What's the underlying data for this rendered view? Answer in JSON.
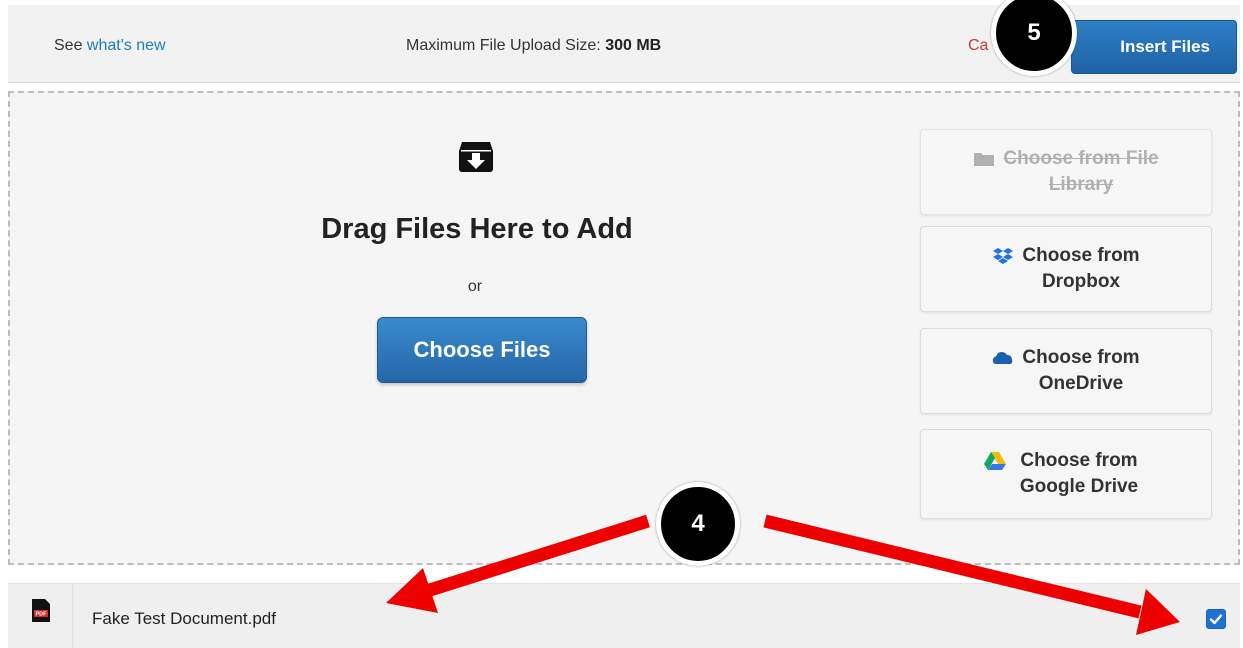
{
  "header": {
    "see_prefix": "See",
    "whats_new_link": "what's new",
    "max_size_label": "Maximum File Upload Size:",
    "max_size_value": "300 MB",
    "cancel_partial": "Ca",
    "insert_button": "Insert Files"
  },
  "dropzone": {
    "title": "Drag Files Here to Add",
    "or_text": "or",
    "choose_button": "Choose Files",
    "sources": [
      {
        "line1": "Choose from File",
        "line2": "Library",
        "icon": "folder-icon",
        "disabled": true
      },
      {
        "line1": "Choose from",
        "line2": "Dropbox",
        "icon": "dropbox-icon",
        "disabled": false
      },
      {
        "line1": "Choose from",
        "line2": "OneDrive",
        "icon": "onedrive-icon",
        "disabled": false
      },
      {
        "line1": "Choose from",
        "line2": "Google Drive",
        "icon": "google-drive-icon",
        "disabled": false
      }
    ]
  },
  "file_list": [
    {
      "name": "Fake Test Document.pdf",
      "icon": "pdf-file-icon",
      "checked": true
    }
  ],
  "annotations": {
    "step_5": "5",
    "step_4": "4"
  },
  "colors": {
    "primary_button": "#2467a8",
    "link": "#1a7fb6",
    "cancel": "#d0363a",
    "arrow": "#ee0000",
    "checkbox": "#1e72d4"
  }
}
